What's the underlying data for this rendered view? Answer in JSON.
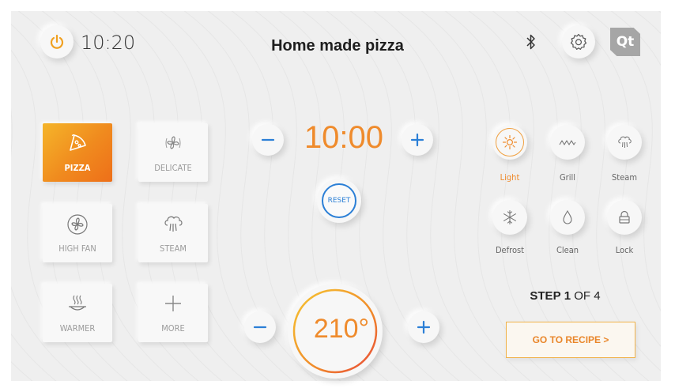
{
  "header": {
    "time": "10:20",
    "title": "Home made pizza",
    "qt_label": "Qt"
  },
  "modes": [
    {
      "label": "PIZZA",
      "icon": "pizza-icon",
      "active": true
    },
    {
      "label": "DELICATE",
      "icon": "fan-icon",
      "active": false
    },
    {
      "label": "HIGH FAN",
      "icon": "high-fan-icon",
      "active": false
    },
    {
      "label": "STEAM",
      "icon": "steam-icon",
      "active": false
    },
    {
      "label": "WARMER",
      "icon": "warmer-icon",
      "active": false
    },
    {
      "label": "MORE",
      "icon": "plus-icon",
      "active": false
    }
  ],
  "timer": {
    "value": "10:00",
    "reset_label": "RESET"
  },
  "temperature": {
    "value": "210°"
  },
  "quick": [
    {
      "label": "Light",
      "icon": "sun-icon",
      "active": true
    },
    {
      "label": "Grill",
      "icon": "grill-icon",
      "active": false
    },
    {
      "label": "Steam",
      "icon": "steam-cloud-icon",
      "active": false
    },
    {
      "label": "Defrost",
      "icon": "snowflake-icon",
      "active": false
    },
    {
      "label": "Clean",
      "icon": "drop-icon",
      "active": false
    },
    {
      "label": "Lock",
      "icon": "lock-icon",
      "active": false
    }
  ],
  "step": {
    "prefix": "STEP",
    "current": "1",
    "suffix": "OF 4"
  },
  "recipe_button": "GO TO RECIPE >",
  "colors": {
    "accent": "#ef8b2c",
    "blue": "#2b7fd6",
    "background": "#efefef"
  }
}
